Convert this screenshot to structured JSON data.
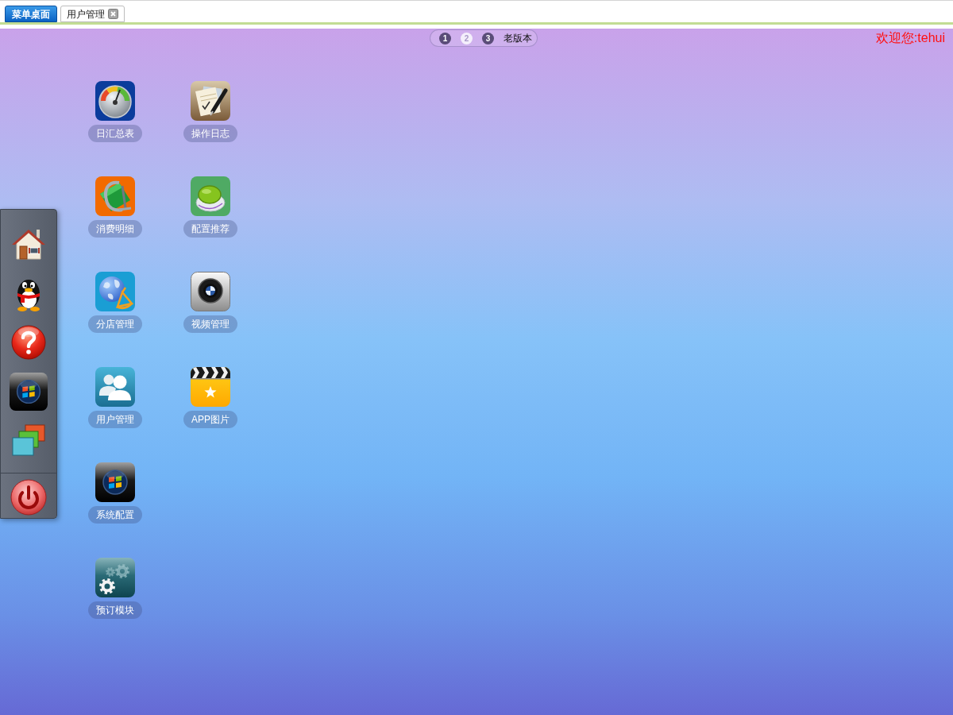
{
  "tabs": [
    {
      "label": "菜单桌面",
      "selected": true,
      "closable": false
    },
    {
      "label": "用户管理",
      "selected": false,
      "closable": true
    }
  ],
  "pager": {
    "pages": [
      {
        "label": "1",
        "selected": false
      },
      {
        "label": "2",
        "selected": true
      },
      {
        "label": "3",
        "selected": false
      }
    ],
    "old_version_link": "老版本"
  },
  "welcome": "欢迎您:tehui",
  "desktop": {
    "icons": [
      {
        "kind": "gauge",
        "label": "日汇总表"
      },
      {
        "kind": "clamp",
        "label": "消费明细"
      },
      {
        "kind": "globe",
        "label": "分店管理"
      },
      {
        "kind": "users",
        "label": "用户管理"
      },
      {
        "kind": "orb",
        "label": "系统配置"
      },
      {
        "kind": "gears",
        "label": "预订模块"
      },
      {
        "kind": "notepad",
        "label": "操作日志"
      },
      {
        "kind": "dome",
        "label": "配置推荐"
      },
      {
        "kind": "lens",
        "label": "视频管理"
      },
      {
        "kind": "clapper",
        "label": "APP图片"
      }
    ]
  }
}
